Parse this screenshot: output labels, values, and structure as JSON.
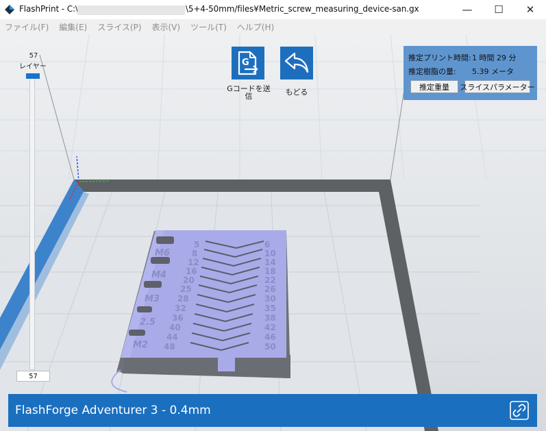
{
  "window": {
    "app_name": "FlashPrint",
    "title_prefix": "FlashPrint - C:\\",
    "title_suffix": "\\5+4-50mm/files¥Metric_screw_measuring_device-san.gx",
    "minimize_glyph": "—",
    "maximize_glyph": "☐",
    "close_glyph": "✕"
  },
  "menu": [
    "ファイル(F)",
    "編集(E)",
    "スライス(P)",
    "表示(V)",
    "ツール(T)",
    "ヘルプ(H)"
  ],
  "layer": {
    "top_number": "57",
    "label": "レイヤー",
    "input_value": "57",
    "slider_level": 1.0
  },
  "toolbar": {
    "send_gcode_line1": "Gコードを送",
    "send_gcode_line2": "信",
    "send_gcode_icon": "G",
    "back_label": "もどる"
  },
  "estimate": {
    "print_time_label": "推定プリント時間:",
    "print_time_value": "1 時間 29 分",
    "filament_label": "推定樹脂の量:",
    "filament_value": "5.39 メータ",
    "weight_button": "推定重量",
    "slice_params_button": "スライスパラメーター"
  },
  "model": {
    "left_labels": [
      "M6",
      "M4",
      "M3",
      "2.5",
      "M2"
    ],
    "center_numbers": [
      "5",
      "8",
      "12",
      "16",
      "20",
      "25",
      "28",
      "32",
      "36",
      "40",
      "44",
      "48"
    ],
    "right_numbers": [
      "6",
      "10",
      "14",
      "18",
      "22",
      "26",
      "30",
      "35",
      "38",
      "42",
      "46",
      "50"
    ]
  },
  "status": {
    "printer": "FlashForge Adventurer 3 - 0.4mm"
  },
  "colors": {
    "accent_blue": "#1a6fbf",
    "model_lavender": "#a9abe9",
    "build_plate": "#dce1e6",
    "border_dark": "#5c5f62"
  }
}
